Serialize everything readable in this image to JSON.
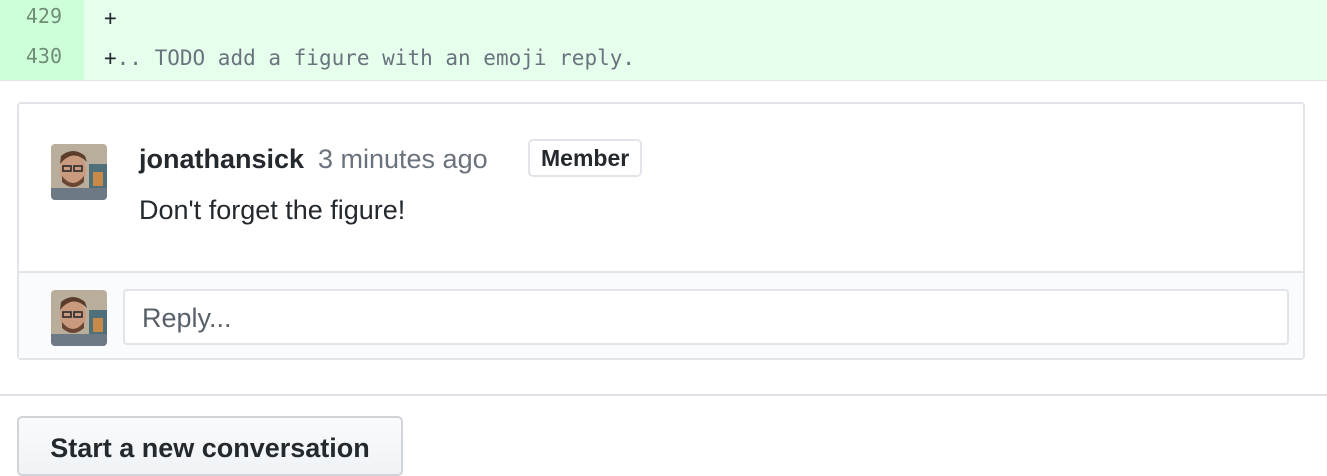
{
  "diff": {
    "lines": [
      {
        "number": "429",
        "prefix": "+",
        "text": ""
      },
      {
        "number": "430",
        "prefix": "+",
        "text": ".. TODO add a figure with an emoji reply."
      }
    ]
  },
  "comment": {
    "author": "jonathansick",
    "timestamp": "3 minutes ago",
    "badge": "Member",
    "body": "Don't forget the figure!"
  },
  "reply": {
    "placeholder": "Reply..."
  },
  "actions": {
    "new_conversation_label": "Start a new conversation"
  },
  "colors": {
    "added_line_bg": "#e6ffed",
    "added_number_bg": "#cdffd8",
    "border": "#e1e4e8"
  }
}
